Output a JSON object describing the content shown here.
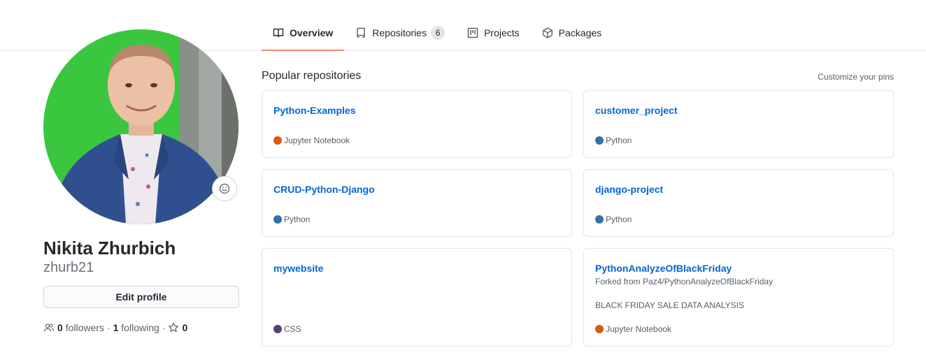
{
  "tabs": [
    {
      "label": "Overview",
      "icon": "book-icon",
      "active": true
    },
    {
      "label": "Repositories",
      "icon": "repo-icon",
      "counter": "6"
    },
    {
      "label": "Projects",
      "icon": "project-icon"
    },
    {
      "label": "Packages",
      "icon": "package-icon"
    }
  ],
  "profile": {
    "fullname": "Nikita Zhurbich",
    "username": "zhurb21",
    "edit_label": "Edit profile",
    "followers_count": "0",
    "followers_label": "followers",
    "following_count": "1",
    "following_label": "following",
    "stars_count": "0",
    "avatar_bg": "#35c93b"
  },
  "popular": {
    "title": "Popular repositories",
    "customize_label": "Customize your pins"
  },
  "repos": [
    {
      "name": "Python-Examples",
      "language": "Jupyter Notebook",
      "lang_color": "#DA5B0B"
    },
    {
      "name": "customer_project",
      "language": "Python",
      "lang_color": "#3572A5"
    },
    {
      "name": "CRUD-Python-Django",
      "language": "Python",
      "lang_color": "#3572A5"
    },
    {
      "name": "django-project",
      "language": "Python",
      "lang_color": "#3572A5"
    },
    {
      "name": "mywebsite",
      "language": "CSS",
      "lang_color": "#563d7c"
    },
    {
      "name": "PythonAnalyzeOfBlackFriday",
      "forked_from": "Forked from Paz4/PythonAnalyzeOfBlackFriday",
      "description": "BLACK FRIDAY SALE DATA ANALYSIS",
      "language": "Jupyter Notebook",
      "lang_color": "#DA5B0B"
    }
  ],
  "colors": {
    "accent_underline": "#f9826c",
    "link": "#0366d6",
    "muted": "#586069"
  }
}
